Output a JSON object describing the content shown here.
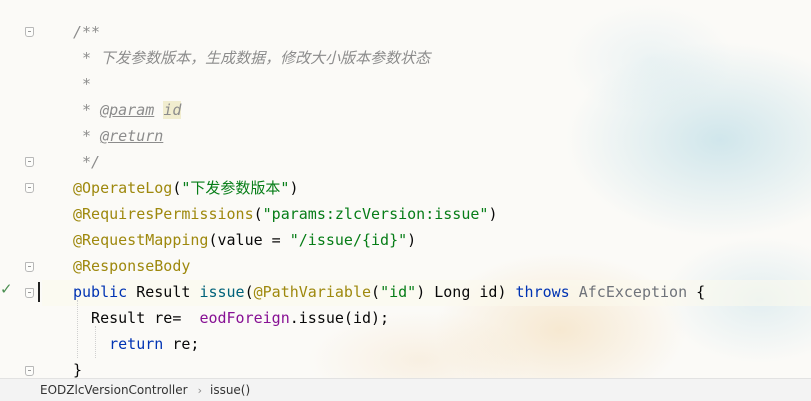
{
  "editor": {
    "lines": [
      [
        {
          "t": "/**",
          "c": "c"
        }
      ],
      [
        {
          "t": " * 下发参数版本，生成数据，修改大小版本参数状态",
          "c": "c"
        }
      ],
      [
        {
          "t": " *",
          "c": "c"
        }
      ],
      [
        {
          "t": " * ",
          "c": "c"
        },
        {
          "t": "@param",
          "c": "tag"
        },
        {
          "t": " ",
          "c": "c"
        },
        {
          "t": "id",
          "c": "pname"
        }
      ],
      [
        {
          "t": " * ",
          "c": "c"
        },
        {
          "t": "@return",
          "c": "tag"
        }
      ],
      [
        {
          "t": " */",
          "c": "c"
        }
      ],
      [
        {
          "t": "@OperateLog",
          "c": "ann"
        },
        {
          "t": "(",
          "c": "txt"
        },
        {
          "t": "\"下发参数版本\"",
          "c": "str"
        },
        {
          "t": ")",
          "c": "txt"
        }
      ],
      [
        {
          "t": "@RequiresPermissions",
          "c": "ann"
        },
        {
          "t": "(",
          "c": "txt"
        },
        {
          "t": "\"params:zlcVersion:issue\"",
          "c": "str"
        },
        {
          "t": ")",
          "c": "txt"
        }
      ],
      [
        {
          "t": "@RequestMapping",
          "c": "ann"
        },
        {
          "t": "(value = ",
          "c": "txt"
        },
        {
          "t": "\"/issue/{id}\"",
          "c": "str"
        },
        {
          "t": ")",
          "c": "txt"
        }
      ],
      [
        {
          "t": "@ResponseBody",
          "c": "ann"
        }
      ],
      [
        {
          "t": "public ",
          "c": "kw"
        },
        {
          "t": "Result ",
          "c": "txt"
        },
        {
          "t": "issue",
          "c": "fn"
        },
        {
          "t": "(",
          "c": "txt"
        },
        {
          "t": "@PathVariable",
          "c": "ann"
        },
        {
          "t": "(",
          "c": "txt"
        },
        {
          "t": "\"id\"",
          "c": "str"
        },
        {
          "t": ") Long id) ",
          "c": "txt"
        },
        {
          "t": "throws ",
          "c": "kw"
        },
        {
          "t": "AfcException ",
          "c": "exc"
        },
        {
          "t": "{",
          "c": "txt"
        }
      ],
      [
        {
          "t": "  Result re=  ",
          "c": "txt"
        },
        {
          "t": "eodForeign",
          "c": "fld"
        },
        {
          "t": ".issue(id);",
          "c": "txt"
        }
      ],
      [
        {
          "t": "    ",
          "c": "txt"
        },
        {
          "t": "return ",
          "c": "kw"
        },
        {
          "t": "re;",
          "c": "txt"
        }
      ],
      [
        {
          "t": "}",
          "c": "txt"
        }
      ]
    ]
  },
  "statusbar": {
    "class_name": "EODZlcVersionController",
    "method_name": "issue()",
    "separator": "›"
  },
  "gutter": {
    "check_glyph": "✓"
  }
}
